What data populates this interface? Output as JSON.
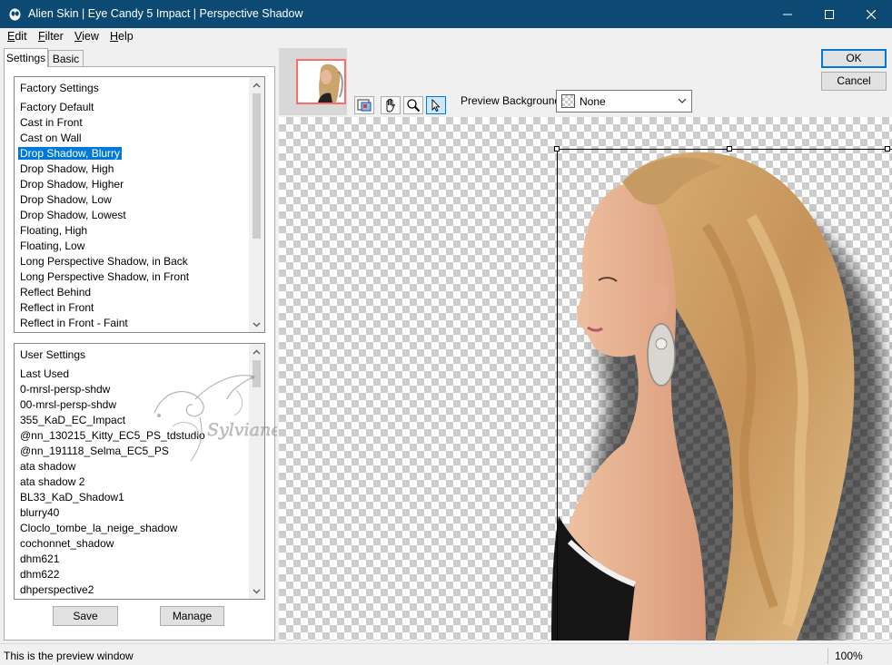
{
  "window": {
    "title": "Alien Skin | Eye Candy 5 Impact | Perspective Shadow",
    "title_bar_color": "#0d4a73"
  },
  "menu": {
    "items": [
      {
        "label": "Edit",
        "accel": "E",
        "rest": "dit"
      },
      {
        "label": "Filter",
        "accel": "F",
        "rest": "ilter"
      },
      {
        "label": "View",
        "accel": "V",
        "rest": "iew"
      },
      {
        "label": "Help",
        "accel": "H",
        "rest": "elp"
      }
    ]
  },
  "tabs": {
    "settings": "Settings",
    "basic": "Basic"
  },
  "factory": {
    "header": "Factory Settings",
    "selected_index": 3,
    "items": [
      "Factory Default",
      "Cast in Front",
      "Cast on Wall",
      "Drop Shadow, Blurry",
      "Drop Shadow, High",
      "Drop Shadow, Higher",
      "Drop Shadow, Low",
      "Drop Shadow, Lowest",
      "Floating, High",
      "Floating, Low",
      "Long Perspective Shadow, in Back",
      "Long Perspective Shadow, in Front",
      "Reflect Behind",
      "Reflect in Front",
      "Reflect in Front - Faint"
    ]
  },
  "user": {
    "header": "User Settings",
    "items": [
      "Last Used",
      "0-mrsl-persp-shdw",
      "00-mrsl-persp-shdw",
      "355_KaD_EC_Impact",
      "@nn_130215_Kitty_EC5_PS_tdstudio",
      "@nn_191118_Selma_EC5_PS",
      "ata shadow",
      "ata shadow 2",
      "BL33_KaD_Shadow1",
      "blurry40",
      "Cloclo_tombe_la_neige_shadow",
      "cochonnet_shadow",
      "dhm621",
      "dhm622",
      "dhperspective2"
    ]
  },
  "buttons": {
    "save": "Save",
    "manage": "Manage",
    "ok": "OK",
    "cancel": "Cancel"
  },
  "watermark": {
    "text": "Sylviane"
  },
  "toolbar": {
    "tools": [
      "navigator-tool-icon",
      "hand-pan-icon",
      "zoom-magnifier-icon",
      "arrow-select-icon"
    ],
    "active_tool": "arrow-select-icon",
    "preview_background_label": "Preview Background:",
    "preview_background_value": "None"
  },
  "status": {
    "message": "This is the preview window",
    "zoom": "100%"
  },
  "colors": {
    "selection_highlight": "#0078d7",
    "navigator_frame": "#ff6a6a"
  }
}
